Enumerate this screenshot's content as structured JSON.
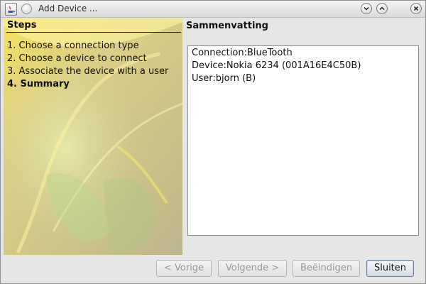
{
  "window": {
    "title": "Add Device ..."
  },
  "titlebar_icons": [
    "java-app-icon",
    "window-menu-icon",
    "minimize-icon",
    "maximize-icon",
    "close-icon"
  ],
  "steps": {
    "heading": "Steps",
    "items": [
      {
        "label": "1. Choose a connection type",
        "active": false
      },
      {
        "label": "2. Choose a device to connect",
        "active": false
      },
      {
        "label": "3. Associate the device with a user",
        "active": false
      },
      {
        "label": "4. Summary",
        "active": true
      }
    ]
  },
  "summary": {
    "title": "Sammenvatting",
    "lines": [
      "Connection:BlueTooth",
      "Device:Nokia 6234 (001A16E4C50B)",
      "User:bjorn (B)"
    ]
  },
  "buttons": {
    "previous": {
      "label": "< Vorige",
      "enabled": false
    },
    "next": {
      "label": "Volgende >",
      "enabled": false
    },
    "finish": {
      "label": "Beëindigen",
      "enabled": false
    },
    "close": {
      "label": "Sluiten",
      "enabled": true
    }
  },
  "colors": {
    "panel_base": "#c9bf8f",
    "accent_yellow": "#ffd84a",
    "accent_green": "#a8d27a",
    "button_focus": "#6e7f9b"
  }
}
